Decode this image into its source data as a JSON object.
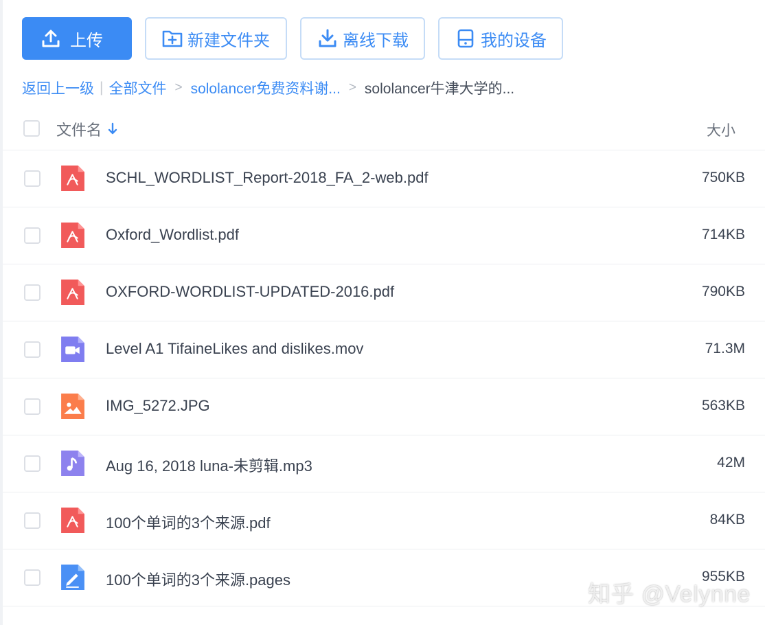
{
  "toolbar": {
    "upload": "上传",
    "new_folder": "新建文件夹",
    "offline_download": "离线下载",
    "my_devices": "我的设备"
  },
  "breadcrumb": {
    "back": "返回上一级",
    "all_files": "全部文件",
    "folder": "sololancer免费资料谢...",
    "current": "sololancer牛津大学的..."
  },
  "list": {
    "col_name": "文件名",
    "col_size": "大小",
    "files": [
      {
        "name": "SCHL_WORDLIST_Report-2018_FA_2-web.pdf",
        "size": "750KB",
        "icon": "pdf-icon"
      },
      {
        "name": "Oxford_Wordlist.pdf",
        "size": "714KB",
        "icon": "pdf-icon"
      },
      {
        "name": "OXFORD-WORDLIST-UPDATED-2016.pdf",
        "size": "790KB",
        "icon": "pdf-icon"
      },
      {
        "name": "Level A1 TifaineLikes and dislikes.mov",
        "size": "71.3M",
        "icon": "video-icon"
      },
      {
        "name": "IMG_5272.JPG",
        "size": "563KB",
        "icon": "image-icon"
      },
      {
        "name": "Aug 16, 2018 luna-未剪辑.mp3",
        "size": "42M",
        "icon": "audio-icon"
      },
      {
        "name": "100个单词的3个来源.pdf",
        "size": "84KB",
        "icon": "pdf-icon"
      },
      {
        "name": "100个单词的3个来源.pages",
        "size": "955KB",
        "icon": "pages-icon"
      }
    ]
  },
  "watermark": "知乎 @Velynne",
  "colors": {
    "accent": "#3b8bf4",
    "pdf": "#f15a5a",
    "video": "#7f7df0",
    "image": "#fb7d4b",
    "audio": "#8d82ee",
    "pages": "#4a90f5"
  }
}
